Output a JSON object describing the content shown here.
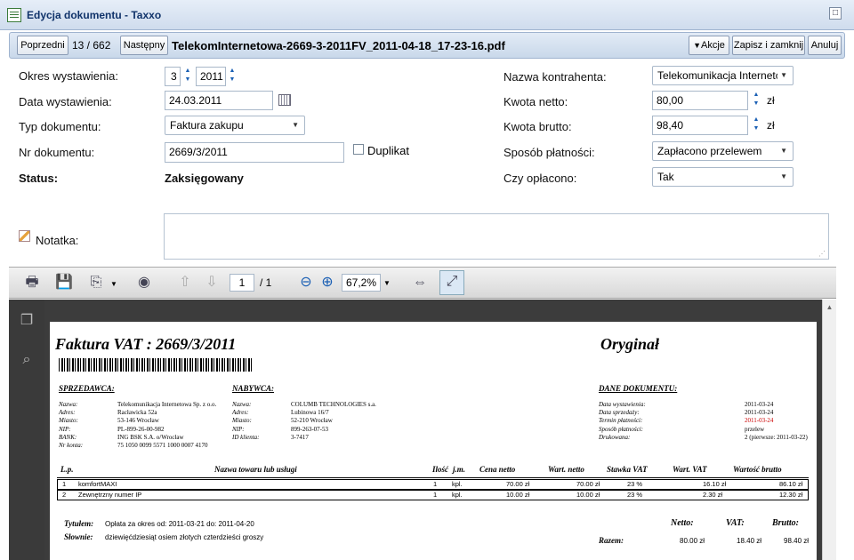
{
  "window": {
    "title": "Edycja dokumentu - Taxxo"
  },
  "toolbar": {
    "prev": "Poprzedni",
    "counter": "13 / 662",
    "next": "Następny",
    "filename": "TelekomInternetowa-2669-3-2011FV_2011-04-18_17-23-16.pdf",
    "actions": "Akcje",
    "save_close": "Zapisz i zamknij",
    "cancel": "Anuluj"
  },
  "form": {
    "period_label": "Okres wystawienia:",
    "period_month": "3",
    "period_year": "2011",
    "date_label": "Data wystawienia:",
    "date_value": "24.03.2011",
    "type_label": "Typ dokumentu:",
    "type_value": "Faktura zakupu",
    "number_label": "Nr dokumentu:",
    "number_value": "2669/3/2011",
    "duplicate": "Duplikat",
    "status_label": "Status:",
    "status_value": "Zaksięgowany",
    "note_label": "Notatka:",
    "contractor_label": "Nazwa kontrahenta:",
    "contractor_value": "Telekomunikacja Internetc",
    "net_label": "Kwota netto:",
    "net_value": "80,00",
    "gross_label": "Kwota brutto:",
    "gross_value": "98,40",
    "currency": "zł",
    "payment_label": "Sposób płatności:",
    "payment_value": "Zapłacono przelewem",
    "paid_label": "Czy opłacono:",
    "paid_value": "Tak"
  },
  "viewer": {
    "page": "1",
    "pages": "/ 1",
    "zoom": "67,2%"
  },
  "invoice": {
    "title": "Faktura VAT : 2669/3/2011",
    "original": "Oryginał",
    "seller_h": "SPRZEDAWCA:",
    "buyer_h": "NABYWCA:",
    "doc_h": "DANE DOKUMENTU:",
    "seller": [
      [
        "Nazwa:",
        "Telekomunikacja Internetowa Sp. z o.o."
      ],
      [
        "Adres:",
        "Racławicka 52a"
      ],
      [
        "Miasto:",
        "53-146 Wrocław"
      ],
      [
        "NIP:",
        "PL-899-26-00-982"
      ],
      [
        "BANK:",
        "ING BSK S.A. o/Wrocław"
      ],
      [
        "Nr konta:",
        "75 1050 0099 5571 1000 0007 4170"
      ]
    ],
    "buyer": [
      [
        "Nazwa:",
        "COLUMB TECHNOLOGIES s.a."
      ],
      [
        "Adres:",
        "Lubinowa 16/7"
      ],
      [
        "Miasto:",
        "52-210 Wrocław"
      ],
      [
        "NIP:",
        "899-263-07-53"
      ],
      [
        "ID klienta:",
        "3-7417"
      ]
    ],
    "doc": [
      [
        "Data wystawienia:",
        "2011-03-24"
      ],
      [
        "Data sprzedaży:",
        "2011-03-24"
      ],
      [
        "Termin płatności:",
        "2011-03-24"
      ],
      [
        "Sposób płatności:",
        "przelew"
      ],
      [
        "Drukowana:",
        "2 (pierwsze: 2011-03-22)"
      ]
    ],
    "cols": [
      "L.p.",
      "Nazwa towaru lub usługi",
      "Ilość",
      "j.m.",
      "Cena netto",
      "Wart. netto",
      "Stawka VAT",
      "Wart. VAT",
      "Wartość brutto"
    ],
    "rows": [
      [
        "1",
        "komfortMAXI",
        "1",
        "kpl.",
        "70.00 zł",
        "70.00 zł",
        "23 %",
        "16.10 zł",
        "86.10 zł"
      ],
      [
        "2",
        "Zewnętrzny numer IP",
        "1",
        "kpl.",
        "10.00 zł",
        "10.00 zł",
        "23 %",
        "2.30 zł",
        "12.30 zł"
      ]
    ],
    "tytulem_l": "Tytułem:",
    "tytulem": "Opłata za okres od: 2011-03-21 do: 2011-04-20",
    "slownie_l": "Słownie:",
    "slownie": "dziewięćdziesiąt osiem złotych czterdzieści groszy",
    "netto_h": "Netto:",
    "vat_h": "VAT:",
    "brutto_h": "Brutto:",
    "razem": "Razem:",
    "sum_net": "80.00 zł",
    "sum_vat": "18.40 zł",
    "sum_gross": "98.40 zł"
  }
}
